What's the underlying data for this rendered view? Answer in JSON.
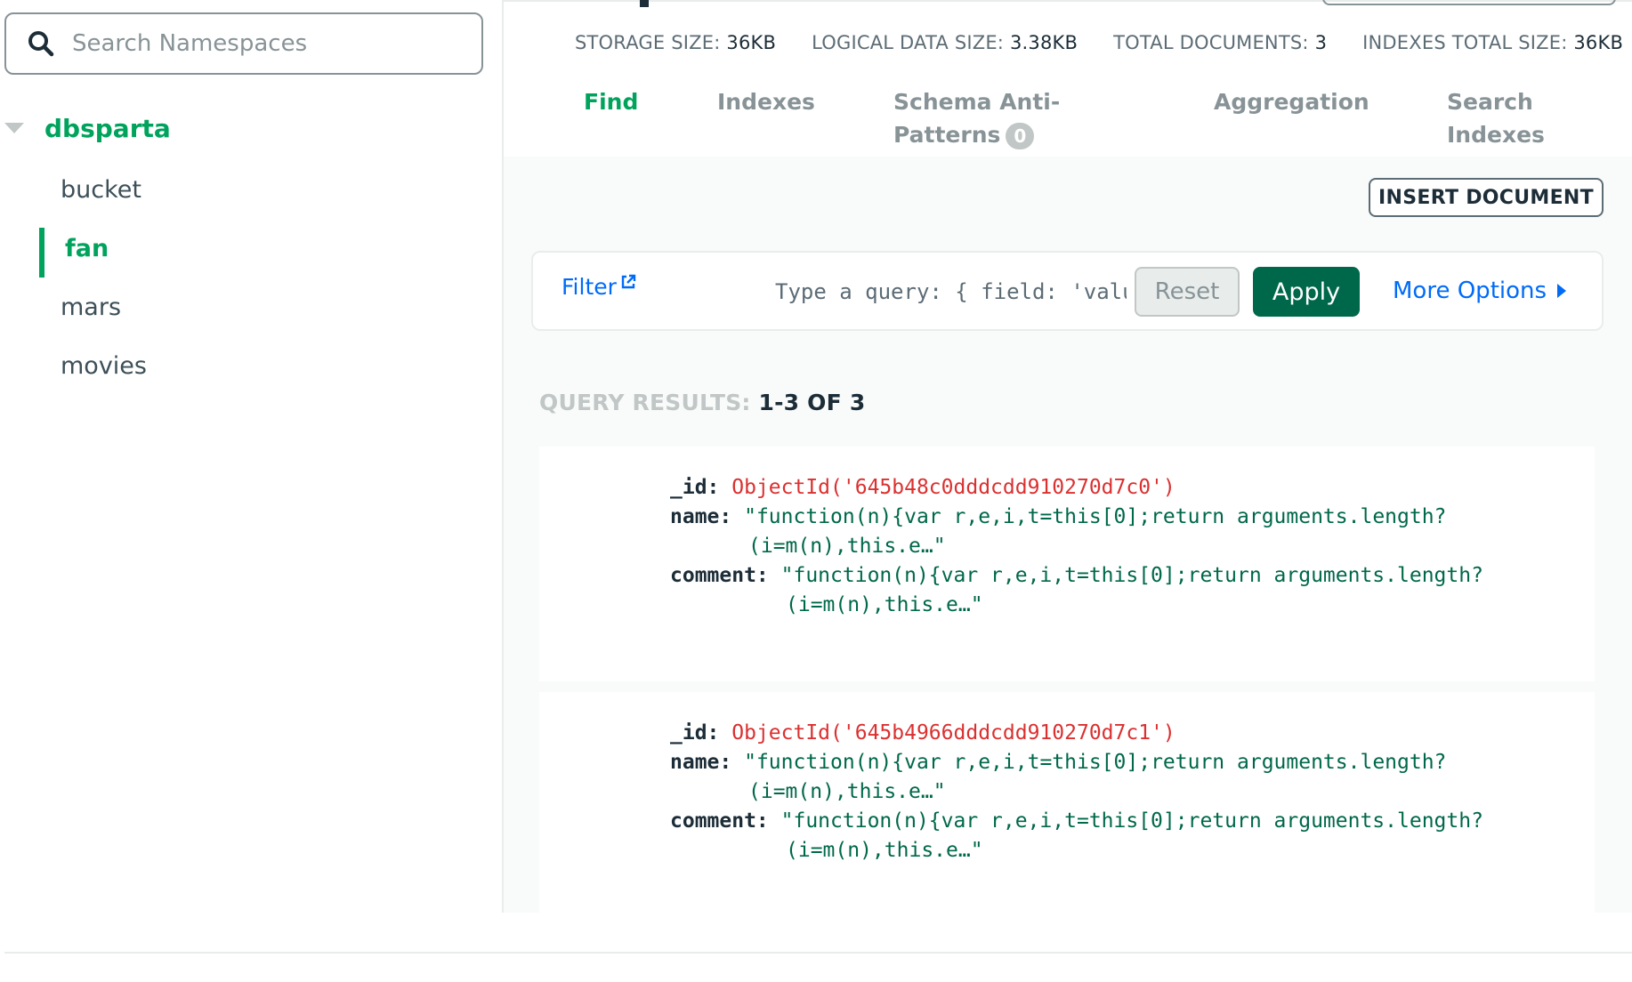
{
  "sidebar": {
    "search_placeholder": "Search Namespaces",
    "database": "dbsparta",
    "collections": [
      "bucket",
      "fan",
      "mars",
      "movies"
    ],
    "active_collection": "fan"
  },
  "stats": {
    "storage_label": "STORAGE SIZE:",
    "storage_value": "36KB",
    "logical_label": "LOGICAL DATA SIZE:",
    "logical_value": "3.38KB",
    "docs_label": "TOTAL DOCUMENTS:",
    "docs_value": "3",
    "indexes_label": "INDEXES TOTAL SIZE:",
    "indexes_value": "36KB"
  },
  "tabs": {
    "find": "Find",
    "indexes": "Indexes",
    "schema_1": "Schema Anti-",
    "schema_2": "Patterns",
    "schema_badge": "0",
    "aggregation": "Aggregation",
    "search_1": "Search",
    "search_2": "Indexes"
  },
  "toolbar": {
    "insert_document": "INSERT DOCUMENT",
    "filter_label": "Filter",
    "query_placeholder": "Type a query: { field: 'value' }",
    "reset": "Reset",
    "apply": "Apply",
    "more_options": "More Options"
  },
  "results": {
    "label": "QUERY RESULTS:",
    "count": "1-3 OF 3"
  },
  "documents": [
    {
      "id_key": "_id:",
      "id_value": "ObjectId('645b48c0dddcdd910270d7c0')",
      "name_key": "name:",
      "name_line1": "\"function(n){var r,e,i,t=this[0];return arguments.length?",
      "name_line2": "(i=m(n),this.e…\"",
      "comment_key": "comment:",
      "comment_line1": "\"function(n){var r,e,i,t=this[0];return arguments.length?",
      "comment_line2": "(i=m(n),this.e…\""
    },
    {
      "id_key": "_id:",
      "id_value": "ObjectId('645b4966dddcdd910270d7c1')",
      "name_key": "name:",
      "name_line1": "\"function(n){var r,e,i,t=this[0];return arguments.length?",
      "name_line2": "(i=m(n),this.e…\"",
      "comment_key": "comment:",
      "comment_line1": "\"function(n){var r,e,i,t=this[0];return arguments.length?",
      "comment_line2": "(i=m(n),this.e…\""
    }
  ],
  "colors": {
    "accent_green": "#00a35c",
    "apply_green": "#00684a",
    "link_blue": "#016bf8",
    "objectid_red": "#db3030"
  },
  "icons": {
    "search": "search-icon",
    "caret": "caret-down-icon",
    "external_link": "external-link-icon",
    "more_options": "triangle-right-icon"
  }
}
